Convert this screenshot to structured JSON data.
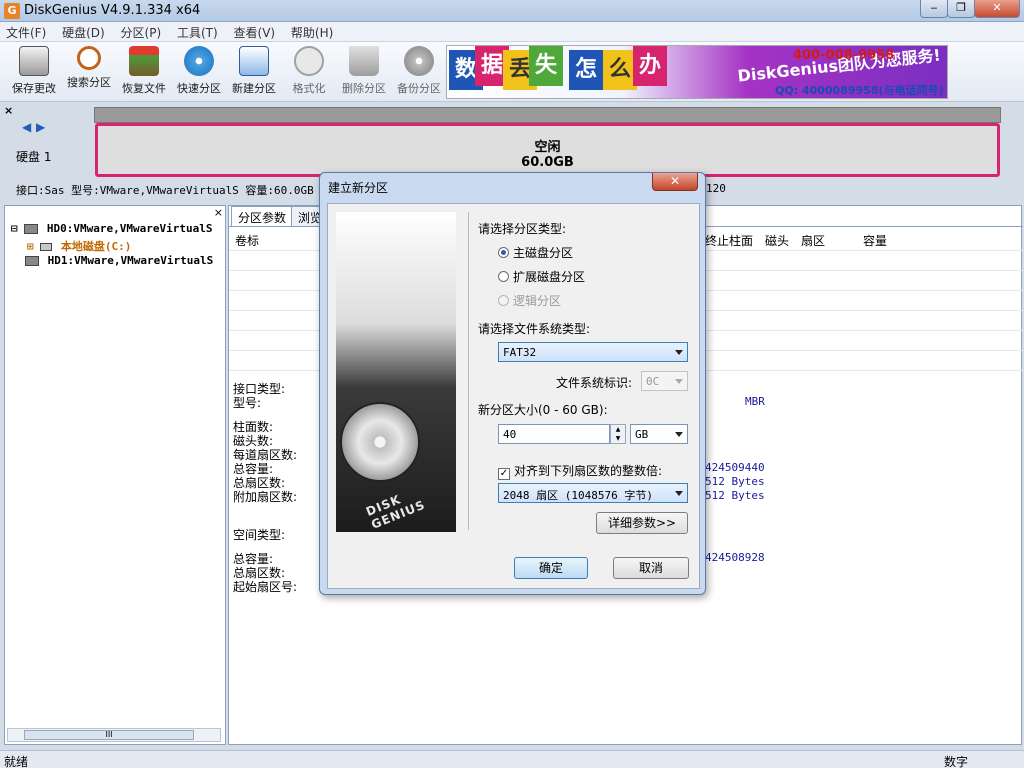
{
  "window": {
    "app_icon": "G",
    "title": "DiskGenius V4.9.1.334 x64",
    "controls": {
      "minimize": "‒",
      "maximize": "❐",
      "close": "✕"
    }
  },
  "menu": [
    "文件(F)",
    "硬盘(D)",
    "分区(P)",
    "工具(T)",
    "查看(V)",
    "帮助(H)"
  ],
  "toolbar": {
    "items": [
      {
        "label": "保存更改",
        "icon": "save-icon",
        "enabled": true
      },
      {
        "label": "搜索分区",
        "icon": "search-icon",
        "enabled": true
      },
      {
        "label": "恢复文件",
        "icon": "recover-icon",
        "enabled": true
      },
      {
        "label": "快速分区",
        "icon": "quick-partition-icon",
        "enabled": true
      },
      {
        "label": "新建分区",
        "icon": "new-partition-icon",
        "enabled": true
      },
      {
        "label": "格式化",
        "icon": "format-icon",
        "enabled": false
      },
      {
        "label": "删除分区",
        "icon": "delete-icon",
        "enabled": false
      },
      {
        "label": "备份分区",
        "icon": "backup-icon",
        "enabled": false
      }
    ]
  },
  "ad": {
    "blocks": [
      "数",
      "据",
      "丢",
      "失",
      "怎",
      "么",
      "办"
    ],
    "team_text": "DiskGenius团队为您服务!",
    "phone": "400-008-9958",
    "qq": "QQ: 4000089958(与电话同号)"
  },
  "disk_map": {
    "close_label": "×",
    "nav_left": "◀",
    "nav_right": "▶",
    "disk_label": "硬盘 1",
    "partition_name": "空闲",
    "partition_size": "60.0GB",
    "info_line": "接口:Sas  型号:VMware,VMwareVirtualS  容量:60.0GB",
    "info_tail": "120"
  },
  "tree": {
    "close_label": "×",
    "rows": [
      {
        "expander": "⊟",
        "text": "HD0:VMware,VMwareVirtualS",
        "type": "disk"
      },
      {
        "expander": "⊞",
        "text": "本地磁盘(C:)",
        "type": "partition"
      },
      {
        "expander": "",
        "text": "HD1:VMware,VMwareVirtualS",
        "type": "disk"
      }
    ],
    "scroll_thumb": "III"
  },
  "main": {
    "tabs": [
      "分区参数",
      "浏览"
    ],
    "columns": [
      "卷标",
      "终止柱面",
      "磁头",
      "扇区",
      "容量"
    ],
    "labels_top": [
      "接口类型:",
      "型号:"
    ],
    "labels_mid": [
      "柱面数:",
      "磁头数:",
      "每道扇区数:",
      "总容量:",
      "总扇区数:",
      "附加扇区数:"
    ],
    "label_space": "空间类型:",
    "labels_bot": [
      "总容量:",
      "总扇区数:",
      "起始扇区号:"
    ],
    "values": {
      "mbr": "MBR",
      "bytes_total": "424509440",
      "sector_size1": "512 Bytes",
      "sector_size2": "512 Bytes",
      "bytes_free": "424508928"
    }
  },
  "dialog": {
    "title": "建立新分区",
    "close_label": "✕",
    "brand_text": "DISK GENIUS",
    "partition_type_label": "请选择分区类型:",
    "partition_types": [
      {
        "label": "主磁盘分区",
        "checked": true,
        "enabled": true
      },
      {
        "label": "扩展磁盘分区",
        "checked": false,
        "enabled": true
      },
      {
        "label": "逻辑分区",
        "checked": false,
        "enabled": false
      }
    ],
    "fs_type_label": "请选择文件系统类型:",
    "fs_type_value": "FAT32",
    "fs_id_label": "文件系统标识:",
    "fs_id_value": "0C",
    "size_label": "新分区大小(0 - 60 GB):",
    "size_value": "40",
    "size_unit": "GB",
    "align_checked": true,
    "align_mark": "✓",
    "align_label": "对齐到下列扇区数的整数倍:",
    "align_value": "2048 扇区 (1048576 字节)",
    "advanced_button": "详细参数>>",
    "ok_button": "确定",
    "cancel_button": "取消"
  },
  "status": {
    "left": "就绪",
    "right": "数字"
  },
  "colors": {
    "accent": "#d6246e",
    "titlebar": "#b4c9e4",
    "dialog_frame": "#c9daf0"
  }
}
